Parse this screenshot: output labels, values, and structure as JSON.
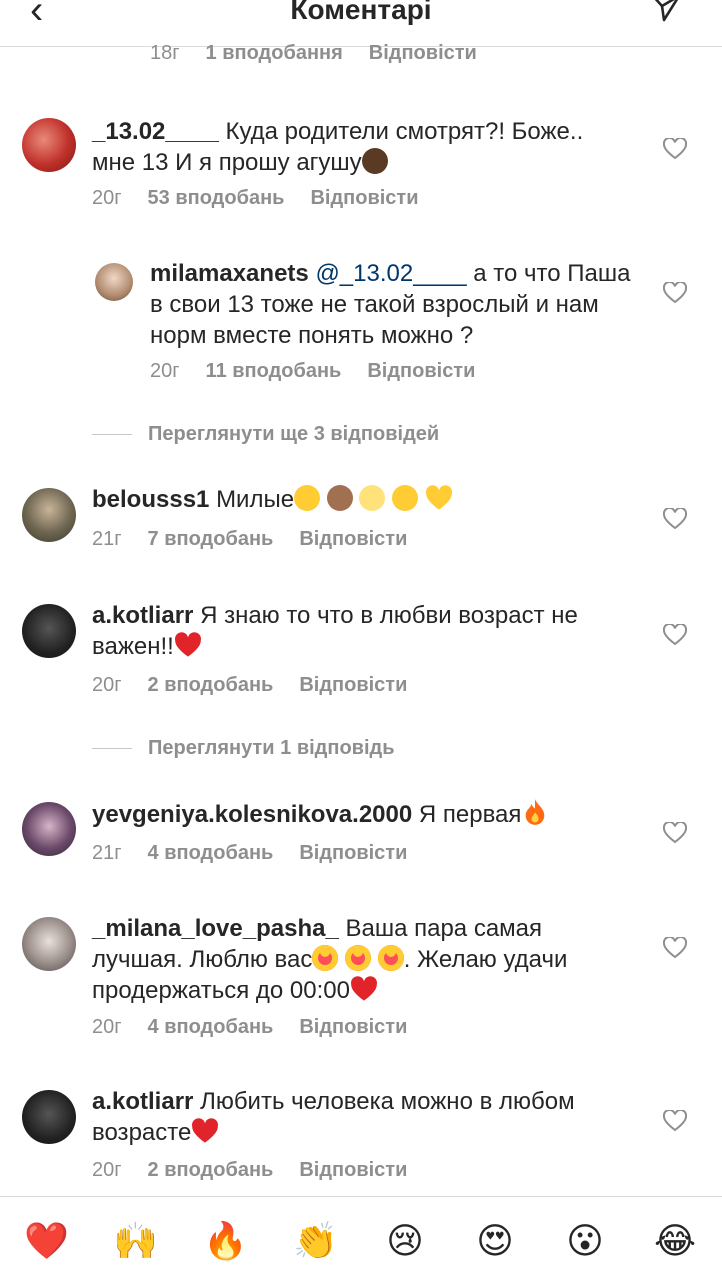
{
  "header": {
    "title": "Коментарі"
  },
  "top_meta": {
    "time": "18г",
    "likes": "1 вподобання",
    "reply": "Відповісти"
  },
  "comments": [
    {
      "user": "_13.02____",
      "text": "Куда родители смотрят?! Боже.. мне 13 И я прошу  агушу",
      "time": "20г",
      "likes": "53 вподобань",
      "reply": "Відповісти"
    },
    {
      "user": "milamaxanets",
      "mention": "@_13.02____",
      "text": " а то что Паша в свои 13 тоже не такой взрослый и нам норм вместе понять можно ?",
      "time": "20г",
      "likes": "11 вподобань",
      "reply": "Відповісти"
    },
    {
      "user": "belousss1",
      "text": "Милые",
      "time": "21г",
      "likes": "7 вподобань",
      "reply": "Відповісти"
    },
    {
      "user": "a.kotliarr",
      "text": "Я знаю то что в любви возраст не важен!!",
      "time": "20г",
      "likes": "2 вподобань",
      "reply": "Відповісти"
    },
    {
      "user": "yevgeniya.kolesnikova.2000",
      "text": "Я первая",
      "time": "21г",
      "likes": "4 вподобань",
      "reply": "Відповісти"
    },
    {
      "user": "_milana_love_pasha_",
      "text": "Ваша пара самая лучшая. Люблю вас",
      "text2": ". Желаю удачи продержаться до 00:00",
      "time": "20г",
      "likes": "4 вподобань",
      "reply": "Відповісти"
    },
    {
      "user": "a.kotliarr",
      "text": "Любить человека можно в любом возрасте",
      "time": "20г",
      "likes": "2 вподобань",
      "reply": "Відповісти"
    }
  ],
  "view_replies": [
    "Переглянути ще 3 відповідей",
    "Переглянути 1 відповідь"
  ],
  "reactions": [
    "❤️",
    "🙌",
    "🔥",
    "👏",
    "😢",
    "😍",
    "😮",
    "😂"
  ],
  "colors": {
    "text": "#262626",
    "meta": "#8e8e8e",
    "mention": "#00376b",
    "divider": "#dbdbdb"
  }
}
